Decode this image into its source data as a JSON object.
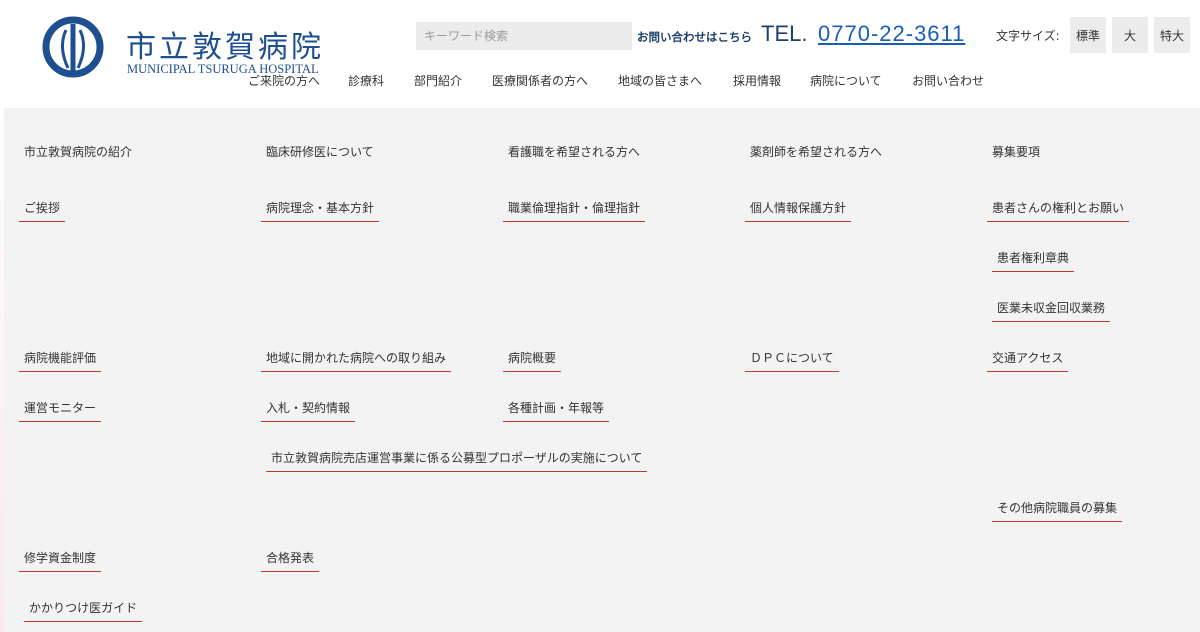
{
  "header": {
    "logo_title": "市立敦賀病院",
    "logo_subtitle": "MUNICIPAL TSURUGA HOSPITAL",
    "search": {
      "placeholder": "キーワード検索"
    },
    "contact_label": "お問い合わせはこちら",
    "tel_label": "TEL.",
    "tel_number": "0770-22-3611",
    "font_size": {
      "label": "文字サイズ:",
      "standard": "標準",
      "large": "大",
      "xlarge": "特大"
    },
    "brand_color": "#1d4f91",
    "accent_color": "#c0392b"
  },
  "gnav": [
    "ご来院の方へ",
    "診療科",
    "部門紹介",
    "医療関係者の方へ",
    "地域の皆さまへ",
    "採用情報",
    "病院について",
    "お問い合わせ"
  ],
  "menu": {
    "row1": [
      "市立敦賀病院の紹介",
      "臨床研修医について",
      "看護職を希望される方へ",
      "薬剤師を希望される方へ",
      "募集要項"
    ],
    "row2": [
      "ご挨拶",
      "病院理念・基本方針",
      "職業倫理指針・倫理指針",
      "個人情報保護方針",
      "患者さんの権利とお願い"
    ],
    "row3": [
      "患者権利章典"
    ],
    "row4": [
      "医業未収金回収業務"
    ],
    "row5": [
      "病院機能評価",
      "地域に開かれた病院への取り組み",
      "病院概要",
      "ＤＰＣについて",
      "交通アクセス"
    ],
    "row6": [
      "運営モニター",
      "入札・契約情報",
      "各種計画・年報等"
    ],
    "row7": [
      "市立敦賀病院売店運営事業に係る公募型プロポーザルの実施について"
    ],
    "row8": [
      "その他病院職員の募集"
    ],
    "row9": [
      "修学資金制度",
      "合格発表"
    ],
    "row10": [
      "かかりつけ医ガイド"
    ]
  }
}
